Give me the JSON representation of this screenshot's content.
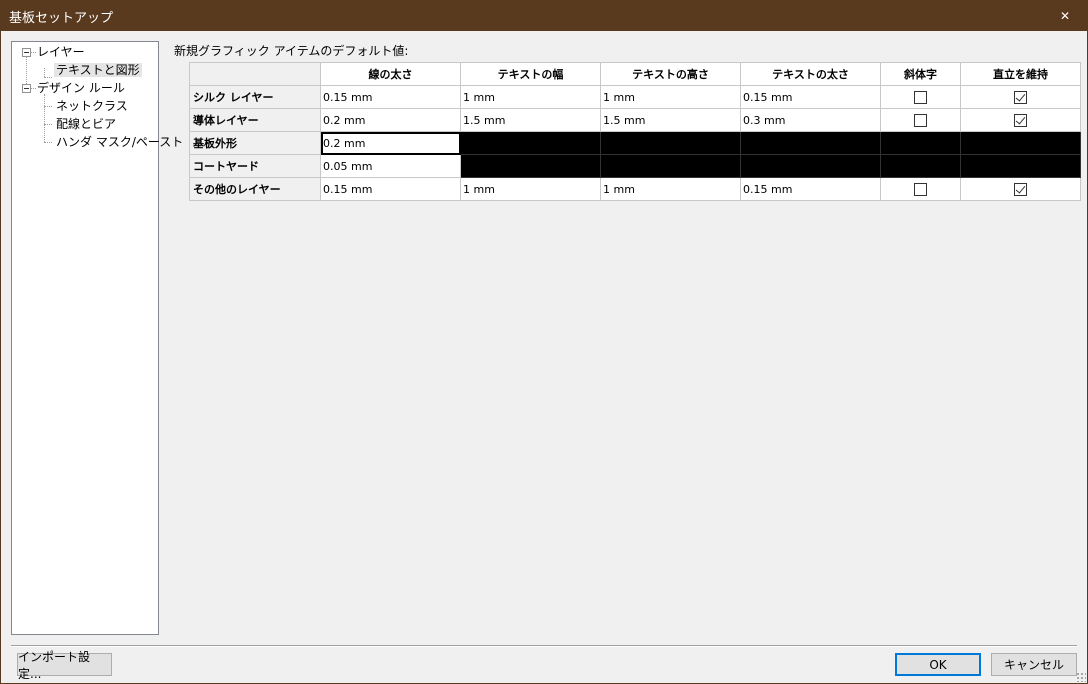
{
  "window": {
    "title": "基板セットアップ",
    "close_glyph": "✕"
  },
  "tree": {
    "items": [
      {
        "label": "レイヤー",
        "level": 0,
        "expanded": true
      },
      {
        "label": "テキストと図形",
        "level": 1,
        "selected": true
      },
      {
        "label": "デザイン ルール",
        "level": 0,
        "expanded": true
      },
      {
        "label": "ネットクラス",
        "level": 1
      },
      {
        "label": "配線とビア",
        "level": 1
      },
      {
        "label": "ハンダ マスク/ペースト",
        "level": 1
      }
    ]
  },
  "grid": {
    "label": "新規グラフィック アイテムのデフォルト値:",
    "columns": [
      "線の太さ",
      "テキストの幅",
      "テキストの高さ",
      "テキストの太さ",
      "斜体字",
      "直立を維持"
    ],
    "rows": [
      {
        "name": "シルク レイヤー",
        "line": "0.15 mm",
        "tw": "1 mm",
        "th": "1 mm",
        "tt": "0.15 mm",
        "italic": false,
        "upright": true,
        "blackout": false
      },
      {
        "name": "導体レイヤー",
        "line": "0.2 mm",
        "tw": "1.5 mm",
        "th": "1.5 mm",
        "tt": "0.3 mm",
        "italic": false,
        "upright": true,
        "blackout": false
      },
      {
        "name": "基板外形",
        "line": "0.2 mm",
        "blackout": true,
        "active": true
      },
      {
        "name": "コートヤード",
        "line": "0.05 mm",
        "blackout": true
      },
      {
        "name": "その他のレイヤー",
        "line": "0.15 mm",
        "tw": "1 mm",
        "th": "1 mm",
        "tt": "0.15 mm",
        "italic": false,
        "upright": true,
        "blackout": false
      }
    ]
  },
  "buttons": {
    "import": "インポート設定...",
    "ok": "OK",
    "cancel": "キャンセル"
  },
  "colors": {
    "titlebar": "#5a3a1e",
    "default_button_border": "#0078d7"
  }
}
